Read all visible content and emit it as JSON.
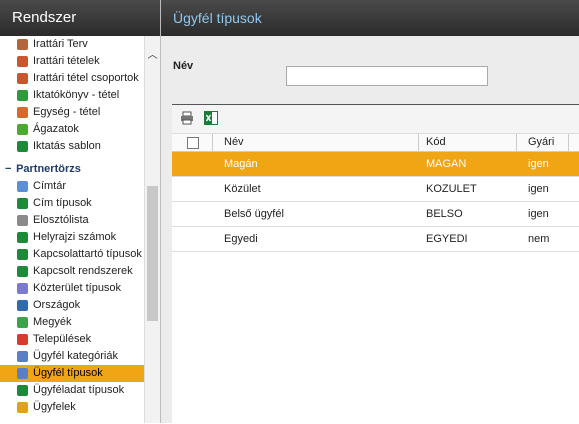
{
  "sidebar": {
    "title": "Rendszer",
    "items_top": [
      {
        "label": "Irattári Terv",
        "icon": "archive-plan-icon",
        "color": "#b5653a"
      },
      {
        "label": "Irattári tételek",
        "icon": "archive-items-icon",
        "color": "#c9562f"
      },
      {
        "label": "Irattári tétel csoportok",
        "icon": "archive-groups-icon",
        "color": "#c9562f"
      },
      {
        "label": "Iktatókönyv - tétel",
        "icon": "registry-book-icon",
        "color": "#2e9a3b"
      },
      {
        "label": "Egység - tétel",
        "icon": "unit-item-icon",
        "color": "#d46b2b"
      },
      {
        "label": "Ágazatok",
        "icon": "branches-icon",
        "color": "#4caa2f"
      },
      {
        "label": "Iktatás sablon",
        "icon": "registration-template-icon",
        "color": "#1d8a3a"
      }
    ],
    "group": {
      "label": "Partnertörzs",
      "toggle": "−"
    },
    "items_group": [
      {
        "label": "Címtár",
        "icon": "directory-icon",
        "color": "#5b8fd6"
      },
      {
        "label": "Cím típusok",
        "icon": "address-types-icon",
        "color": "#1d8a3a"
      },
      {
        "label": "Eloszt­ólista",
        "icon": "distribution-list-icon",
        "color": "#8a8a8a"
      },
      {
        "label": "Helyrajzi számok",
        "icon": "lot-numbers-icon",
        "color": "#1d8a3a"
      },
      {
        "label": "Kapcsolattartó típusok",
        "icon": "contact-types-icon",
        "color": "#1d8a3a"
      },
      {
        "label": "Kapcsolt rendszerek",
        "icon": "linked-systems-icon",
        "color": "#1d8a3a"
      },
      {
        "label": "Közterület típusok",
        "icon": "public-space-types-icon",
        "color": "#7a7ad0"
      },
      {
        "label": "Országok",
        "icon": "countries-icon",
        "color": "#2f6cae"
      },
      {
        "label": "Megyék",
        "icon": "counties-icon",
        "color": "#3ca34a"
      },
      {
        "label": "Települések",
        "icon": "settlements-icon",
        "color": "#d83a2e"
      },
      {
        "label": "Ügyfél kategóriák",
        "icon": "client-categories-icon",
        "color": "#5a7fc8"
      },
      {
        "label": "Ügyfél típusok",
        "icon": "client-types-icon",
        "color": "#5a7fc8",
        "selected": true
      },
      {
        "label": "Ügyféladat típusok",
        "icon": "client-data-types-icon",
        "color": "#1d8a3a"
      },
      {
        "label": "Ügyfelek",
        "icon": "clients-icon",
        "color": "#e0a020"
      }
    ]
  },
  "main": {
    "title": "Ügyfél típusok",
    "filter_label": "Név",
    "filter_value": "",
    "columns": [
      "Név",
      "Kód",
      "Gyári"
    ],
    "rows": [
      {
        "nev": "Magán",
        "kod": "MAGAN",
        "gyari": "igen",
        "selected": true
      },
      {
        "nev": "Közület",
        "kod": "KOZULET",
        "gyari": "igen"
      },
      {
        "nev": "Belső ügyfél",
        "kod": "BELSO",
        "gyari": "igen"
      },
      {
        "nev": "Egyedi",
        "kod": "EGYEDI",
        "gyari": "nem"
      }
    ]
  },
  "colors": {
    "accent": "#f0a515",
    "header_bg": "#333333",
    "title_color": "#8fc8ec",
    "group_color": "#1f3d6b"
  }
}
